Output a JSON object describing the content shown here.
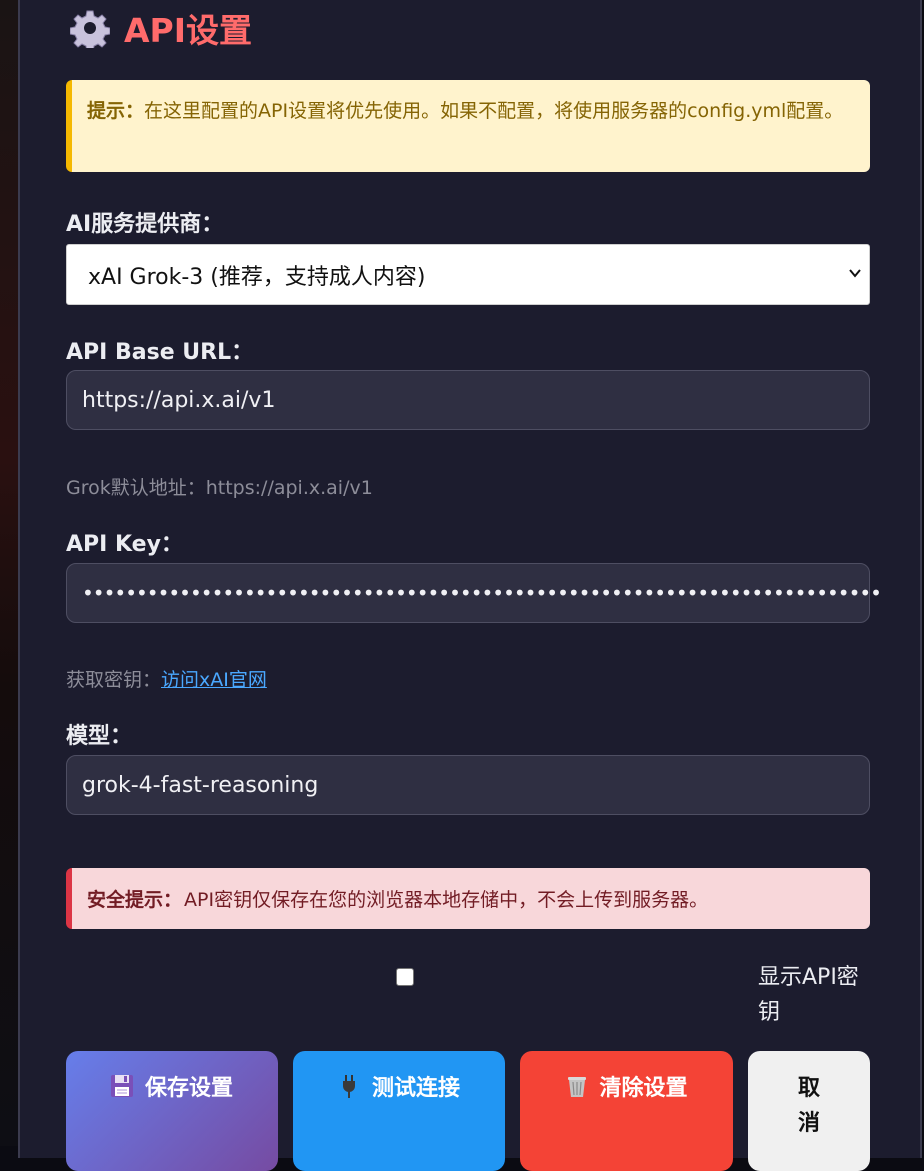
{
  "dialog": {
    "title": "API设置",
    "title_icon": "gear-icon"
  },
  "notice": {
    "strong": "提示：",
    "text": "在这里配置的API设置将优先使用。如果不配置，将使用服务器的config.yml配置。"
  },
  "provider": {
    "label": "AI服务提供商：",
    "selected": "xAI Grok-3 (推荐，支持成人内容)"
  },
  "base_url": {
    "label": "API Base URL：",
    "value": "https://api.x.ai/v1",
    "hint": "Grok默认地址：https://api.x.ai/v1"
  },
  "api_key": {
    "label": "API Key：",
    "masked_value": "••••••••••••••••••••••••••••••••••••••••••••••••••••••••••••••••••••••••••",
    "hint_prefix": "获取密钥：",
    "hint_link": "访问xAI官网"
  },
  "model": {
    "label": "模型：",
    "value": "grok-4-fast-reasoning"
  },
  "security": {
    "strong": "安全提示：",
    "text": "API密钥仅保存在您的浏览器本地存储中，不会上传到服务器。"
  },
  "show_key": {
    "label": "显示API密钥",
    "checked": false
  },
  "buttons": {
    "save": "保存设置",
    "test": "测试连接",
    "clear": "清除设置",
    "cancel": "取消"
  },
  "colors": {
    "title": "#ff6b6b",
    "notice_bg": "#fff3cd",
    "danger_bg": "#f8d7da",
    "save": "#667eea",
    "test": "#2196f3",
    "clear": "#f44336",
    "link": "#4aa8ff"
  }
}
